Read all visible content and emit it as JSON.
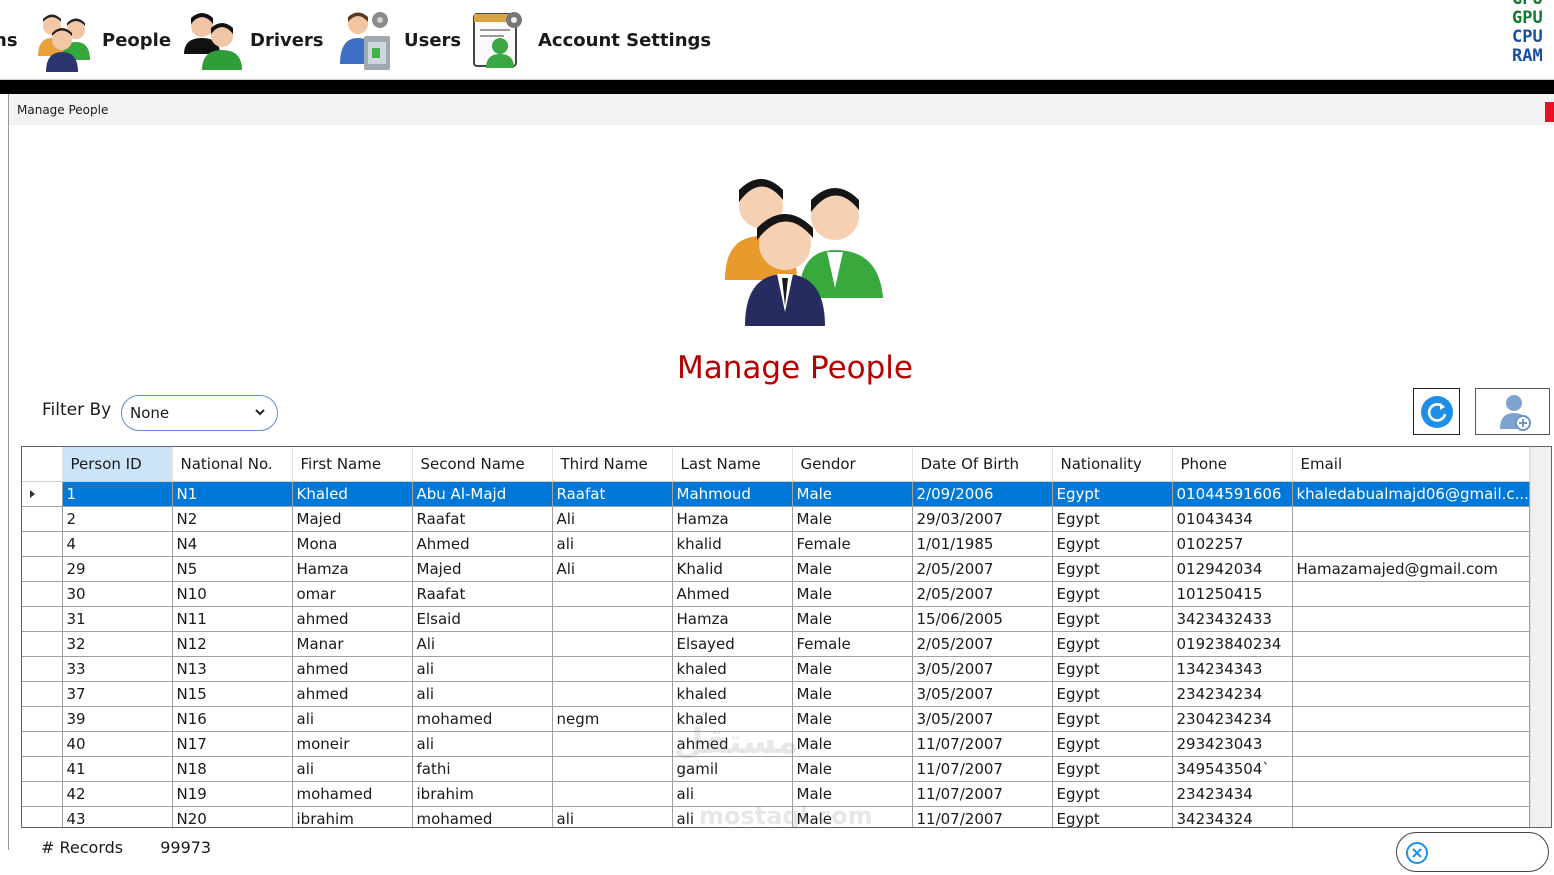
{
  "menubar": {
    "cut_label": "ns",
    "items": [
      {
        "label": "People"
      },
      {
        "label": "Drivers"
      },
      {
        "label": "Users"
      },
      {
        "label": "Account Settings"
      }
    ],
    "perf": [
      "GPU",
      "GPU",
      "CPU",
      "RAM"
    ]
  },
  "window": {
    "title": "Manage People"
  },
  "page": {
    "title": "Manage People",
    "filter_label": "Filter By",
    "filter_value": "None"
  },
  "grid": {
    "columns": [
      "Person ID",
      "National No.",
      "First Name",
      "Second Name",
      "Third Name",
      "Last Name",
      "Gendor",
      "Date Of Birth",
      "Nationality",
      "Phone",
      "Email"
    ],
    "rows": [
      [
        "1",
        "N1",
        "Khaled",
        "Abu Al-Majd",
        "Raafat",
        "Mahmoud",
        "Male",
        "2/09/2006",
        "Egypt",
        "01044591606",
        "khaledabualmajd06@gmail.c..."
      ],
      [
        "2",
        "N2",
        "Majed",
        "Raafat",
        "Ali",
        "Hamza",
        "Male",
        "29/03/2007",
        "Egypt",
        "01043434",
        ""
      ],
      [
        "4",
        "N4",
        "Mona",
        "Ahmed",
        "ali",
        "khalid",
        "Female",
        "1/01/1985",
        "Egypt",
        "0102257",
        ""
      ],
      [
        "29",
        "N5",
        "Hamza",
        "Majed",
        "Ali",
        "Khalid",
        "Male",
        "2/05/2007",
        "Egypt",
        "012942034",
        "Hamazamajed@gmail.com"
      ],
      [
        "30",
        "N10",
        "omar",
        "Raafat",
        "",
        "Ahmed",
        "Male",
        "2/05/2007",
        "Egypt",
        "101250415",
        ""
      ],
      [
        "31",
        "N11",
        "ahmed",
        "Elsaid",
        "",
        "Hamza",
        "Male",
        "15/06/2005",
        "Egypt",
        "3423432433",
        ""
      ],
      [
        "32",
        "N12",
        "Manar",
        "Ali",
        "",
        "Elsayed",
        "Female",
        "2/05/2007",
        "Egypt",
        "01923840234",
        ""
      ],
      [
        "33",
        "N13",
        "ahmed",
        "ali",
        "",
        "khaled",
        "Male",
        "3/05/2007",
        "Egypt",
        "134234343",
        ""
      ],
      [
        "37",
        "N15",
        "ahmed",
        "ali",
        "",
        "khaled",
        "Male",
        "3/05/2007",
        "Egypt",
        "234234234",
        ""
      ],
      [
        "39",
        "N16",
        "ali",
        "mohamed",
        "negm",
        "khaled",
        "Male",
        "3/05/2007",
        "Egypt",
        "2304234234",
        ""
      ],
      [
        "40",
        "N17",
        "moneir",
        "ali",
        "",
        "ahmed",
        "Male",
        "11/07/2007",
        "Egypt",
        "293423043",
        ""
      ],
      [
        "41",
        "N18",
        "ali",
        "fathi",
        "",
        "gamil",
        "Male",
        "11/07/2007",
        "Egypt",
        "349543504`",
        ""
      ],
      [
        "42",
        "N19",
        "mohamed",
        "ibrahim",
        "",
        "ali",
        "Male",
        "11/07/2007",
        "Egypt",
        "23423434",
        ""
      ],
      [
        "43",
        "N20",
        "ibrahim",
        "mohamed",
        "ali",
        "ali",
        "Male",
        "11/07/2007",
        "Egypt",
        "34234324",
        ""
      ]
    ],
    "selected_row": 0
  },
  "footer": {
    "records_label": "# Records",
    "records_value": "99973"
  },
  "watermark": {
    "line1": "مستقل",
    "line2": "mostaql.com"
  },
  "colors": {
    "accent": "#0078d7",
    "title_red": "#b40000",
    "refresh_blue": "#1e8fe8"
  }
}
